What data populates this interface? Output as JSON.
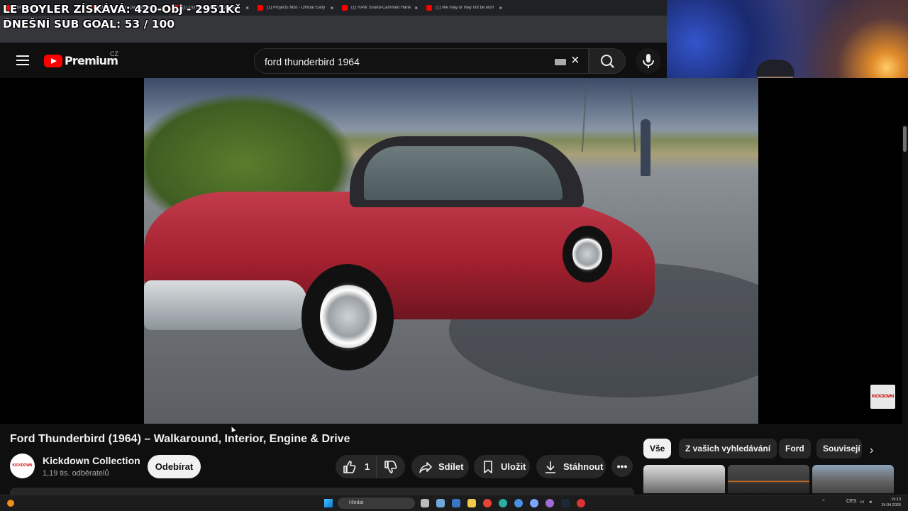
{
  "overlay": {
    "line1": "LE BOYLER ZÍSKÁVÁ: 420-Obj - 2951Kč",
    "line2": "DNEŠNÍ SUB GOAL: 53 / 100"
  },
  "browser": {
    "tabs": [
      {
        "title": "...bm17 - Yo"
      },
      {
        "title": "(1) The Blood of Dawnwalker -"
      },
      {
        "title": "(1) Guns 'n Goblins - Official R"
      },
      {
        "title": "(1) Projects Mist - Official Early"
      },
      {
        "title": "(1) RAW Sound-Cammed Harle"
      },
      {
        "title": "(1) We may or may not be worl"
      }
    ],
    "tab_close": "×",
    "colors": {
      "tab_favicon": "#ff0000",
      "chrome_bg": "#202124"
    }
  },
  "youtube": {
    "logo_text": "Premium",
    "country": "CZ",
    "search_query": "ford thunderbird 1964",
    "clear_glyph": "×",
    "colors": {
      "brand": "#ff0000",
      "bg": "#0f0f0f"
    }
  },
  "video": {
    "title": "Ford Thunderbird (1964) – Walkaround, Interior, Engine & Drive",
    "watermark": "KICKDOWN"
  },
  "channel": {
    "name": "Kickdown Collection",
    "subscribers": "1,19 tis. odběratelů",
    "avatar_text": "KICKDOWN COLLECTION",
    "subscribe_label": "Odebírat"
  },
  "actions": {
    "like_count": "1",
    "share": "Sdílet",
    "save": "Uložit",
    "download": "Stáhnout",
    "more": "•••"
  },
  "chips": [
    "Vše",
    "Z vašich vyhledávání",
    "Ford",
    "Souvisejí"
  ],
  "chip_next": "›",
  "taskbar": {
    "search_placeholder": "Hledat",
    "lang": "CES",
    "time": "19:13",
    "date": "24.04.2026"
  }
}
